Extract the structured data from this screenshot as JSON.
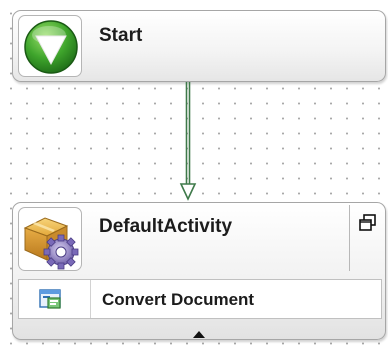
{
  "workflow": {
    "start_node": {
      "title": "Start",
      "icon": "start-down-arrow-icon"
    },
    "connector": {
      "color": "#3f7a4a"
    },
    "activity_node": {
      "title": "DefaultActivity",
      "icon": "activity-package-gear-icon",
      "expand_icon": "restore-window-icon",
      "steps": [
        {
          "label": "Convert Document",
          "icon": "convert-document-icon"
        }
      ],
      "collapse_icon": "collapse-up-triangle-icon"
    }
  }
}
